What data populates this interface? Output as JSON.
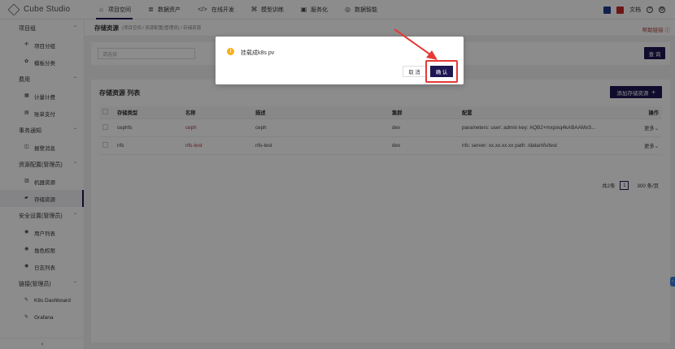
{
  "app": {
    "name": "Cube Studio"
  },
  "topnav": [
    {
      "label": "项目空间",
      "icon": "home-icon",
      "glyph": "⌂",
      "active": true
    },
    {
      "label": "数据资产",
      "icon": "database-icon",
      "glyph": "≣",
      "active": false
    },
    {
      "label": "在线开发",
      "icon": "code-icon",
      "glyph": "</>",
      "active": false
    },
    {
      "label": "模型训练",
      "icon": "cluster-icon",
      "glyph": "⌘",
      "active": false
    },
    {
      "label": "服务化",
      "icon": "service-icon",
      "glyph": "▣",
      "active": false
    },
    {
      "label": "数据智能",
      "icon": "brain-icon",
      "glyph": "◎",
      "active": false
    }
  ],
  "topright": {
    "docs_label": "文档",
    "help_glyph": "?",
    "settings_glyph": "⚙"
  },
  "sidebar": {
    "groups": [
      {
        "label": "项目组",
        "items": [
          {
            "label": "项目分组",
            "glyph": "✣"
          },
          {
            "label": "模板分类",
            "glyph": "✿"
          }
        ]
      },
      {
        "label": "费用",
        "items": [
          {
            "label": "计量计费",
            "glyph": "▦"
          },
          {
            "label": "账单支付",
            "glyph": "▤"
          }
        ]
      },
      {
        "label": "事务通知",
        "items": [
          {
            "label": "报警消息",
            "glyph": "◫"
          }
        ]
      },
      {
        "label": "资源配置(管理员)",
        "items": [
          {
            "label": "机器资源",
            "glyph": "▥"
          },
          {
            "label": "存储资源",
            "glyph": "▰",
            "active": true
          }
        ]
      },
      {
        "label": "安全设置(管理员)",
        "items": [
          {
            "label": "用户列表",
            "glyph": "◉"
          },
          {
            "label": "角色权限",
            "glyph": "◉"
          },
          {
            "label": "日志列表",
            "glyph": "◉"
          }
        ]
      },
      {
        "label": "链接(管理员)",
        "items": [
          {
            "label": "K8s Dashboard",
            "glyph": "✎"
          },
          {
            "label": "Grafana",
            "glyph": "✎"
          }
        ]
      }
    ],
    "collapse_glyph": "‹"
  },
  "breadcrumb": {
    "title": "存储资源",
    "path": "(项目空间 / 资源配置(管理员) / 存储资源"
  },
  "help_link": "帮助链接 ⓘ",
  "filter": {
    "placeholder": "请选择",
    "query_label": "查 询"
  },
  "panel": {
    "title": "存储资源 列表",
    "add_label": "添加存储资源",
    "columns": [
      "存储类型",
      "名称",
      "描述",
      "集群",
      "配置",
      "操作"
    ],
    "rows": [
      {
        "type": "cephfs",
        "name": "ceph",
        "desc": "ceph",
        "cluster": "dev",
        "config": "parameters: user: admin key: AQB2+mxpixq4kABAAMxS...",
        "action": "更多"
      },
      {
        "type": "nfs",
        "name": "nfs-test",
        "desc": "nfs-test",
        "cluster": "dev",
        "config": "nfs: server: xx.xx.xx.xx path: /data/nfs/test",
        "action": "更多"
      }
    ],
    "pager": {
      "total": "共2条",
      "page": "1",
      "size": "300 条/页"
    }
  },
  "modal": {
    "message": "挂载成k8s pv",
    "cancel_label": "取 消",
    "confirm_label": "确 认"
  },
  "colors": {
    "primary": "#1e1653",
    "accent_red": "#e53935",
    "warning": "#faad14"
  }
}
